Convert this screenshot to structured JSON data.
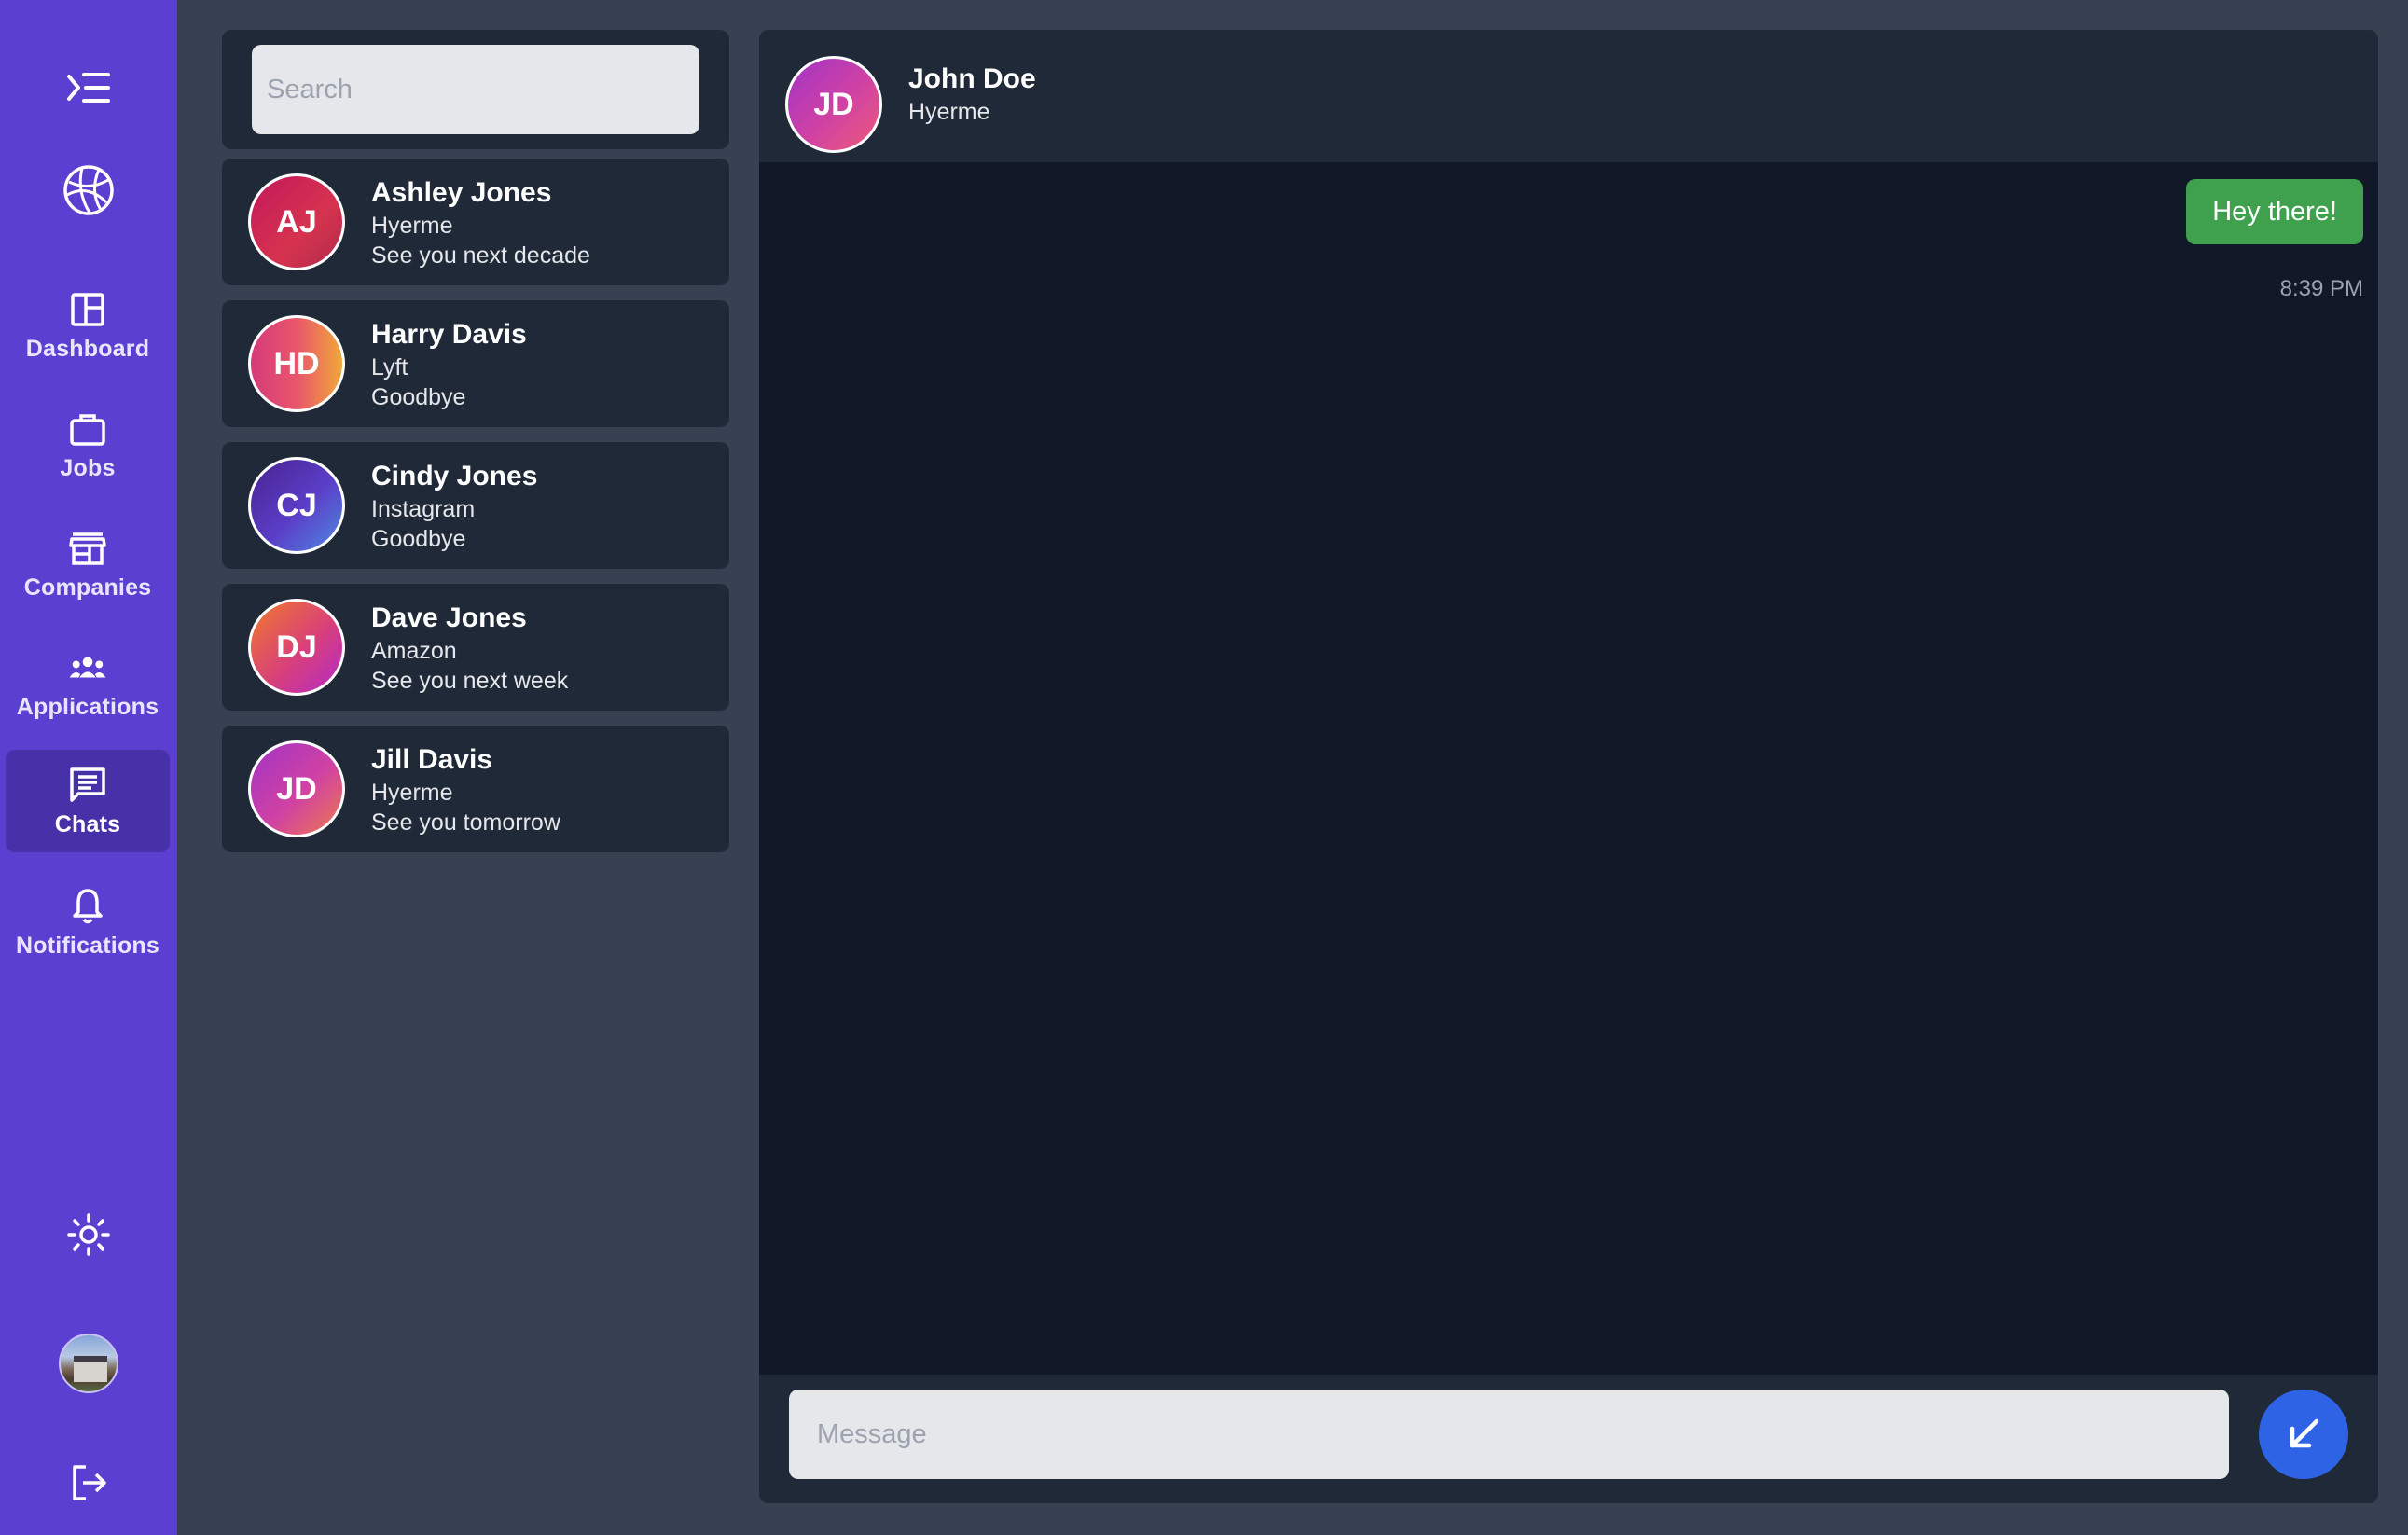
{
  "sidebar": {
    "nav": [
      {
        "label": "Dashboard",
        "icon": "dashboard-icon",
        "active": false
      },
      {
        "label": "Jobs",
        "icon": "briefcase-icon",
        "active": false
      },
      {
        "label": "Companies",
        "icon": "storefront-icon",
        "active": false
      },
      {
        "label": "Applications",
        "icon": "people-icon",
        "active": false
      },
      {
        "label": "Chats",
        "icon": "chat-icon",
        "active": true
      },
      {
        "label": "Notifications",
        "icon": "bell-icon",
        "active": false
      }
    ],
    "accent_color": "#5b3fd0"
  },
  "search": {
    "placeholder": "Search",
    "value": ""
  },
  "contacts": [
    {
      "initials": "AJ",
      "name": "Ashley Jones",
      "company": "Hyerme",
      "last_message": "See you next decade"
    },
    {
      "initials": "HD",
      "name": "Harry Davis",
      "company": "Lyft",
      "last_message": "Goodbye"
    },
    {
      "initials": "CJ",
      "name": "Cindy Jones",
      "company": "Instagram",
      "last_message": "Goodbye"
    },
    {
      "initials": "DJ",
      "name": "Dave Jones",
      "company": "Amazon",
      "last_message": "See you next week"
    },
    {
      "initials": "JD",
      "name": "Jill Davis",
      "company": "Hyerme",
      "last_message": "See you tomorrow"
    }
  ],
  "chat": {
    "header": {
      "initials": "JD",
      "name": "John Doe",
      "company": "Hyerme"
    },
    "messages": [
      {
        "text": "Hey there!",
        "time": "8:39 PM",
        "outgoing": true,
        "color": "#3fa14e"
      }
    ],
    "composer": {
      "placeholder": "Message",
      "value": ""
    },
    "send_color": "#2f63e6"
  }
}
